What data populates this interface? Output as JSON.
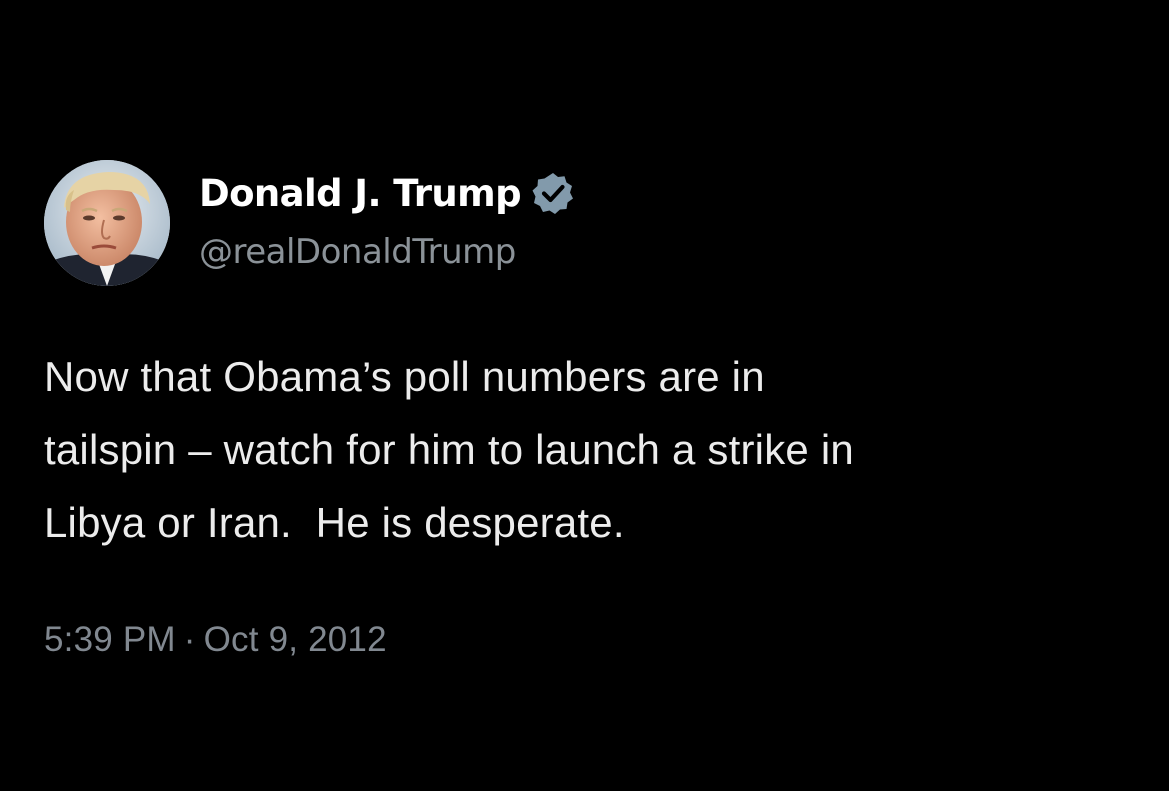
{
  "tweet": {
    "author": {
      "display_name": "Donald J. Trump",
      "handle": "@realDonaldTrump",
      "verified_icon": "verified-badge-icon",
      "avatar": "profile-avatar"
    },
    "text_lines": [
      "Now that Obama’s poll numbers are in",
      "tailspin – watch for him to launch a strike in",
      "Libya or Iran.  He is desperate."
    ],
    "time": "5:39 PM",
    "separator": "·",
    "date": "Oct 9, 2012"
  },
  "colors": {
    "background": "#000000",
    "name": "#ffffff",
    "handle": "#8b9298",
    "body_text": "#ececec",
    "timestamp": "#818890",
    "verified_badge": "#829aab"
  }
}
